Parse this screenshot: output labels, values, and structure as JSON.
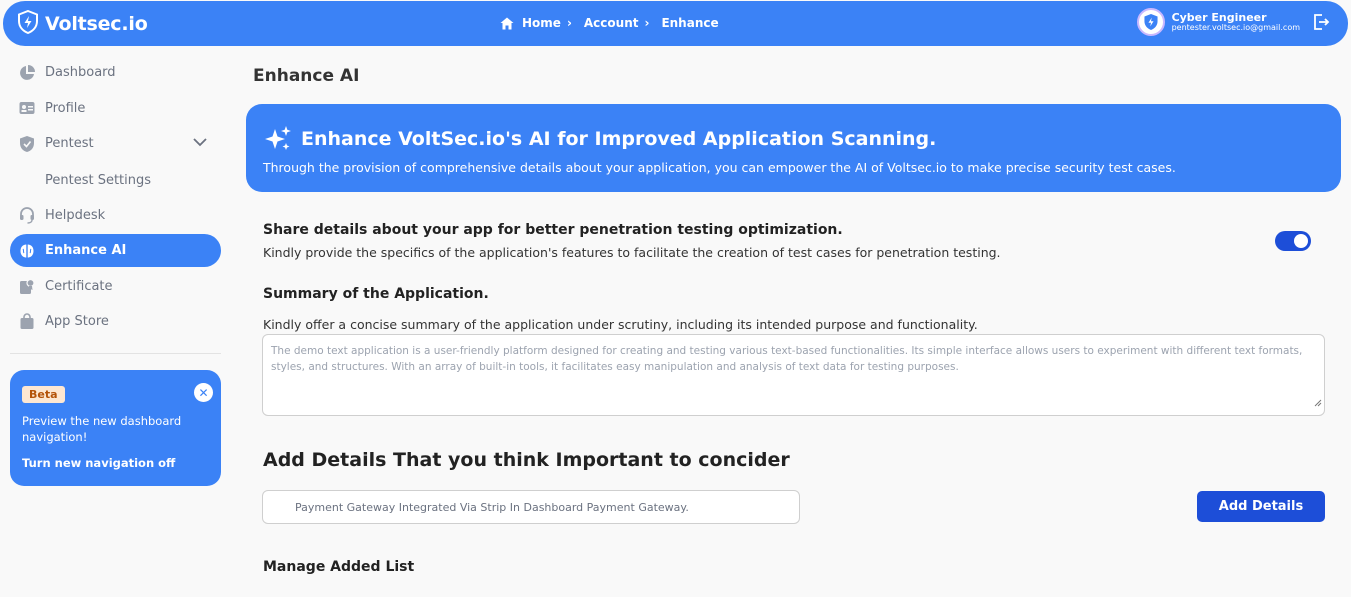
{
  "app": {
    "brand": "Voltsec.io"
  },
  "breadcrumb": {
    "items": [
      "Home",
      "Account",
      "Enhance"
    ]
  },
  "user": {
    "name": "Cyber Engineer",
    "email": "pentester.voltsec.io@gmail.com"
  },
  "sidebar": {
    "items": [
      {
        "label": "Dashboard",
        "icon": "pie-chart-icon"
      },
      {
        "label": "Profile",
        "icon": "id-card-icon"
      },
      {
        "label": "Pentest",
        "icon": "shield-icon"
      },
      {
        "label": "Pentest Settings"
      },
      {
        "label": "Helpdesk",
        "icon": "headset-icon"
      },
      {
        "label": "Enhance AI",
        "icon": "brain-icon",
        "active": true
      },
      {
        "label": "Certificate",
        "icon": "certificate-icon"
      },
      {
        "label": "App Store",
        "icon": "bag-icon"
      }
    ],
    "beta_card": {
      "badge": "Beta",
      "text": "Preview the new dashboard navigation!",
      "link": "Turn new navigation off"
    }
  },
  "main": {
    "page_title": "Enhance AI",
    "banner": {
      "title": "Enhance VoltSec.io's AI for Improved Application Scanning.",
      "subtitle": "Through the provision of comprehensive details about your application, you can empower the AI of Voltsec.io to make precise security test cases."
    },
    "share": {
      "title": "Share details about your app for better penetration testing optimization.",
      "subtitle": "Kindly provide the specifics of the application's features to facilitate the creation of test cases for penetration testing.",
      "toggle_on": true
    },
    "summary": {
      "title": "Summary of the Application.",
      "subtitle": "Kindly offer a concise summary of the application under scrutiny, including its intended purpose and functionality.",
      "placeholder": "The demo text application is a user-friendly platform designed for creating and testing various text-based functionalities. Its simple interface allows users to experiment with different text formats, styles, and structures. With an array of built-in tools, it facilitates easy manipulation and analysis of text data for testing purposes."
    },
    "add_details": {
      "title": "Add Details That you think Important to concider",
      "input_value": "Payment Gateway Integrated Via Strip In Dashboard Payment Gateway.",
      "button": "Add Details"
    },
    "manage": {
      "title": "Manage Added List"
    }
  },
  "colors": {
    "primary": "#3b82f6",
    "primary_dark": "#1d4ed8"
  }
}
